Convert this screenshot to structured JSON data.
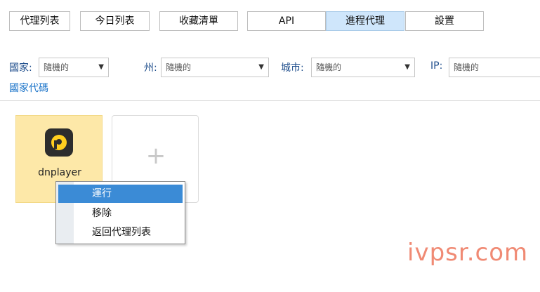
{
  "tabs": [
    {
      "label": "代理列表"
    },
    {
      "label": "今日列表"
    },
    {
      "label": "收藏清單"
    },
    {
      "label": "API"
    },
    {
      "label": "進程代理"
    },
    {
      "label": "設置"
    }
  ],
  "active_tab": "進程代理",
  "filters": {
    "country": {
      "label": "國家:",
      "value": "隨機的"
    },
    "state": {
      "label": "州:",
      "value": "隨機的"
    },
    "city": {
      "label": "城市:",
      "value": "隨機的"
    },
    "ip": {
      "label": "IP:",
      "value": "隨機的"
    }
  },
  "country_code_link": "國家代碼",
  "app": {
    "name": "dnplayer",
    "icon": "dnplayer-icon"
  },
  "add_card": {
    "icon": "plus-icon"
  },
  "context_menu": {
    "items": [
      {
        "label": "運行"
      },
      {
        "label": "移除"
      },
      {
        "label": "返回代理列表"
      }
    ],
    "highlighted": "運行"
  },
  "watermark": "ivpsr.com",
  "colors": {
    "accent": "#3b8bd6",
    "active_tab_bg": "#cfe6fb",
    "app_card_bg": "#fde8a8",
    "link": "#1a73c9",
    "watermark": "#f08a74"
  }
}
